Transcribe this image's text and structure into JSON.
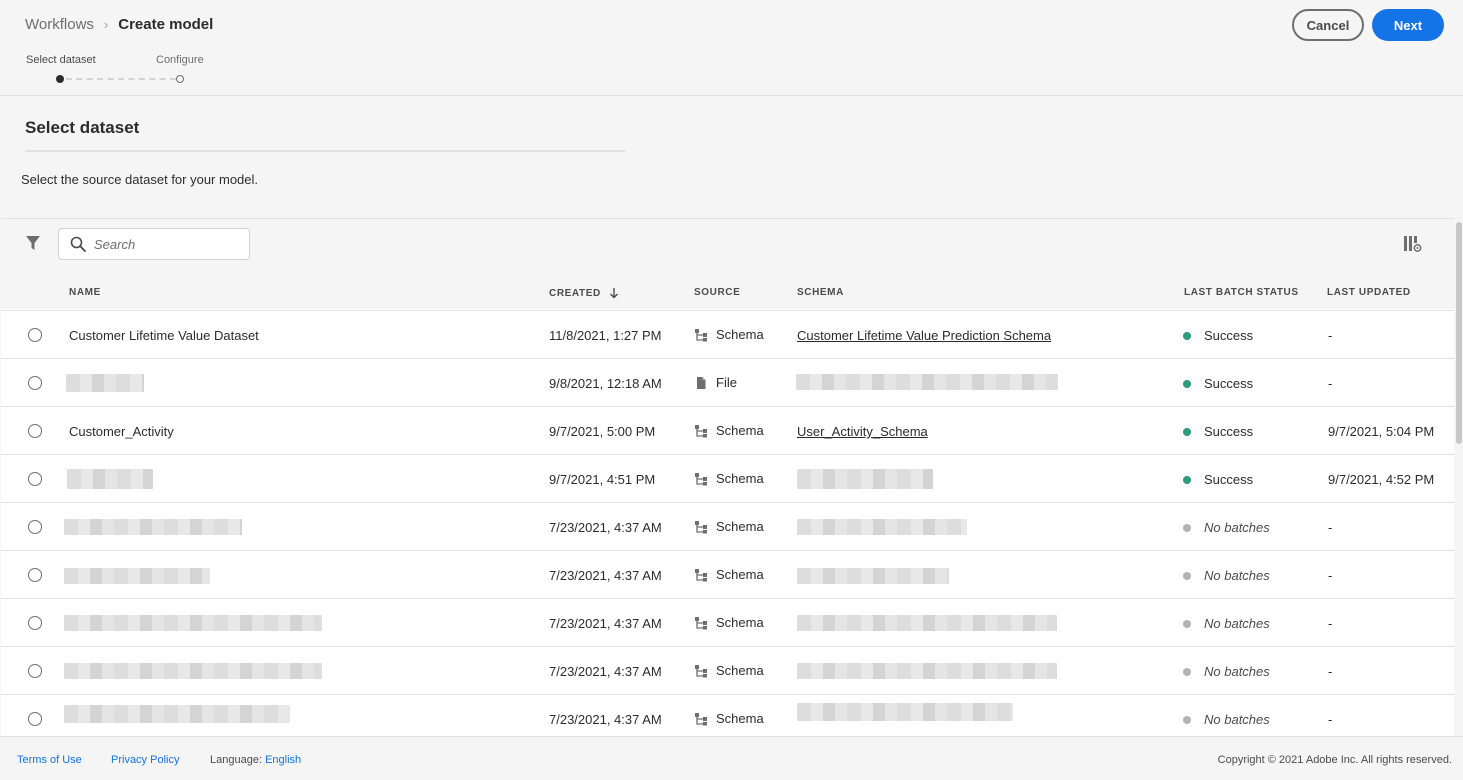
{
  "breadcrumb": {
    "parent": "Workflows",
    "separator": "›",
    "current": "Create model"
  },
  "actions": {
    "cancel": "Cancel",
    "next": "Next"
  },
  "steps": [
    {
      "label": "Select dataset",
      "state": "active"
    },
    {
      "label": "Configure",
      "state": "pending"
    }
  ],
  "section": {
    "title": "Select dataset",
    "description": "Select the source dataset for your model."
  },
  "search": {
    "placeholder": "Search"
  },
  "table": {
    "headers": {
      "name": "NAME",
      "created": "CREATED",
      "source": "SOURCE",
      "schema": "SCHEMA",
      "status": "LAST BATCH STATUS",
      "updated": "LAST UPDATED"
    },
    "rows": [
      {
        "name": "Customer Lifetime Value Dataset",
        "created": "11/8/2021, 1:27 PM",
        "source": "Schema",
        "schema": "Customer Lifetime Value Prediction Schema",
        "status": "Success",
        "updated": "-"
      },
      {
        "name": "",
        "created": "9/8/2021, 12:18 AM",
        "source": "File",
        "schema": "",
        "status": "Success",
        "updated": "-"
      },
      {
        "name": "Customer_Activity",
        "created": "9/7/2021, 5:00 PM",
        "source": "Schema",
        "schema": "User_Activity_Schema",
        "status": "Success",
        "updated": "9/7/2021, 5:04 PM"
      },
      {
        "name": "",
        "created": "9/7/2021, 4:51 PM",
        "source": "Schema",
        "schema": "",
        "status": "Success",
        "updated": "9/7/2021, 4:52 PM"
      },
      {
        "name": "",
        "created": "7/23/2021, 4:37 AM",
        "source": "Schema",
        "schema": "",
        "status": "No batches",
        "updated": "-"
      },
      {
        "name": "",
        "created": "7/23/2021, 4:37 AM",
        "source": "Schema",
        "schema": "",
        "status": "No batches",
        "updated": "-"
      },
      {
        "name": "",
        "created": "7/23/2021, 4:37 AM",
        "source": "Schema",
        "schema": "",
        "status": "No batches",
        "updated": "-"
      },
      {
        "name": "",
        "created": "7/23/2021, 4:37 AM",
        "source": "Schema",
        "schema": "",
        "status": "No batches",
        "updated": "-"
      },
      {
        "name": "",
        "created": "7/23/2021, 4:37 AM",
        "source": "Schema",
        "schema": "",
        "status": "No batches",
        "updated": "-"
      }
    ]
  },
  "colors": {
    "accent": "#1473e6",
    "success": "#2d9d78",
    "neutral": "#b3b3b3"
  },
  "footer": {
    "terms": "Terms of Use",
    "privacy": "Privacy Policy",
    "language_label": "Language:",
    "language_value": "English",
    "copyright": "Copyright ©  2021 Adobe Inc.  All rights reserved."
  }
}
